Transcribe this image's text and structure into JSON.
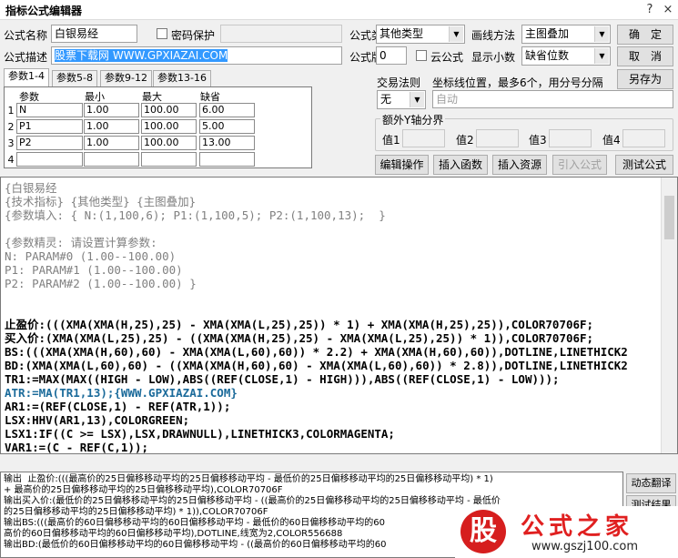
{
  "window": {
    "title": "指标公式编辑器",
    "help_glyph": "?",
    "close_glyph": "×"
  },
  "form": {
    "name_label": "公式名称",
    "name_value": "白银易经",
    "password_label": "密码保护",
    "desc_label": "公式描述",
    "desc_value": "股票下载网 WWW.GPXIAZAI.COM",
    "type_label": "公式类型",
    "type_value": "其他类型",
    "draw_label": "画线方法",
    "draw_value": "主图叠加",
    "version_label": "公式版本",
    "version_value": "0",
    "cloud_label": "云公式",
    "decimals_label": "显示小数",
    "decimals_value": "缺省位数",
    "ok_label": "确　定",
    "cancel_label": "取　消",
    "saveas_label": "另存为",
    "trade_rule_label": "交易法则",
    "trade_rule_value": "无",
    "coord_label": "坐标线位置，最多6个，用分号分隔",
    "coord_value": "自动",
    "yaxis_group_label": "额外Y轴分界",
    "yaxis": [
      {
        "label": "值1",
        "value": ""
      },
      {
        "label": "值2",
        "value": ""
      },
      {
        "label": "值3",
        "value": ""
      },
      {
        "label": "值4",
        "value": ""
      }
    ]
  },
  "tabs": [
    "参数1-4",
    "参数5-8",
    "参数9-12",
    "参数13-16"
  ],
  "params": {
    "headers": [
      "参数",
      "最小",
      "最大",
      "缺省"
    ],
    "rows": [
      {
        "num": "1",
        "name": "N",
        "min": "1.00",
        "max": "100.00",
        "def": "6.00"
      },
      {
        "num": "2",
        "name": "P1",
        "min": "1.00",
        "max": "100.00",
        "def": "5.00"
      },
      {
        "num": "3",
        "name": "P2",
        "min": "1.00",
        "max": "100.00",
        "def": "13.00"
      },
      {
        "num": "4",
        "name": "",
        "min": "",
        "max": "",
        "def": ""
      }
    ]
  },
  "actions": [
    "编辑操作",
    "插入函数",
    "插入资源",
    "引入公式",
    "测试公式"
  ],
  "code_lines": [
    {
      "t": "{白银易经",
      "c": "#808080"
    },
    {
      "t": "{技术指标} {其他类型} {主图叠加}",
      "c": "#808080"
    },
    {
      "t": "{参数填入: { N:(1,100,6); P1:(1,100,5); P2:(1,100,13);  }",
      "c": "#808080"
    },
    {
      "t": "",
      "c": "#000"
    },
    {
      "t": "{参数精灵: 请设置计算参数:",
      "c": "#808080"
    },
    {
      "t": "N: PARAM#0 (1.00--100.00)",
      "c": "#808080"
    },
    {
      "t": "P1: PARAM#1 (1.00--100.00)",
      "c": "#808080"
    },
    {
      "t": "P2: PARAM#2 (1.00--100.00) }",
      "c": "#808080"
    },
    {
      "t": "",
      "c": "#000"
    },
    {
      "t": "",
      "c": "#000"
    },
    {
      "t": "止盈价:(((XMA(XMA(H,25),25) - XMA(XMA(L,25),25)) * 1) + XMA(XMA(H,25),25)),COLOR70706F;",
      "c": "#000"
    },
    {
      "t": "买入价:(XMA(XMA(L,25),25) - ((XMA(XMA(H,25),25) - XMA(XMA(L,25),25)) * 1)),COLOR70706F;",
      "c": "#000"
    },
    {
      "t": "BS:(((XMA(XMA(H,60),60) - XMA(XMA(L,60),60)) * 2.2) + XMA(XMA(H,60),60)),DOTLINE,LINETHICK2",
      "c": "#000"
    },
    {
      "t": "BD:(XMA(XMA(L,60),60) - ((XMA(XMA(H,60),60) - XMA(XMA(L,60),60)) * 2.8)),DOTLINE,LINETHICK2",
      "c": "#000"
    },
    {
      "t": "TR1:=MAX(MAX((HIGH - LOW),ABS((REF(CLOSE,1) - HIGH))),ABS((REF(CLOSE,1) - LOW)));",
      "c": "#000"
    },
    {
      "t": "ATR:=MA(TR1,13);{WWW.GPXIAZAI.COM}",
      "c": "#000"
    },
    {
      "t": "AR1:=(REF(CLOSE,1) - REF(ATR,1));",
      "c": "#000"
    },
    {
      "t": "LSX:HHV(AR1,13),COLORGREEN;",
      "c": "#000"
    },
    {
      "t": "LSX1:IF((C >= LSX),LSX,DRAWNULL),LINETHICK3,COLORMAGENTA;",
      "c": "#000"
    },
    {
      "t": "VAR1:=(C - REF(C,1));",
      "c": "#000"
    }
  ],
  "output_lines": [
    "输出  止盈价:(((最高价的25日偏移移动平均的25日偏移移动平均 - 最低价的25日偏移移动平均的25日偏移移动平均) * 1)",
    "+ 最高价的25日偏移移动平均的25日偏移移动平均),COLOR70706F",
    "输出买入价:(最低价的25日偏移移动平均的25日偏移移动平均 - ((最高价的25日偏移移动平均的25日偏移移动平均 - 最低价",
    "的25日偏移移动平均的25日偏移移动平均) * 1)),COLOR70706F",
    "输出BS:(((最高价的60日偏移移动平均的60日偏移移动平均 - 最低价的60日偏移移动平均的60",
    "高价的60日偏移移动平均的60日偏移移动平均),DOTLINE,线宽为2,COLOR556688",
    "输出BD:(最低价的60日偏移移动平均的60日偏移移动平均 - ((最高价的60日偏移移动平均的60"
  ],
  "side_buttons": [
    "动态翻译",
    "测试结果"
  ],
  "watermark": {
    "glyph": "股",
    "text": "公式之家",
    "url": "www.gszj100.com"
  }
}
